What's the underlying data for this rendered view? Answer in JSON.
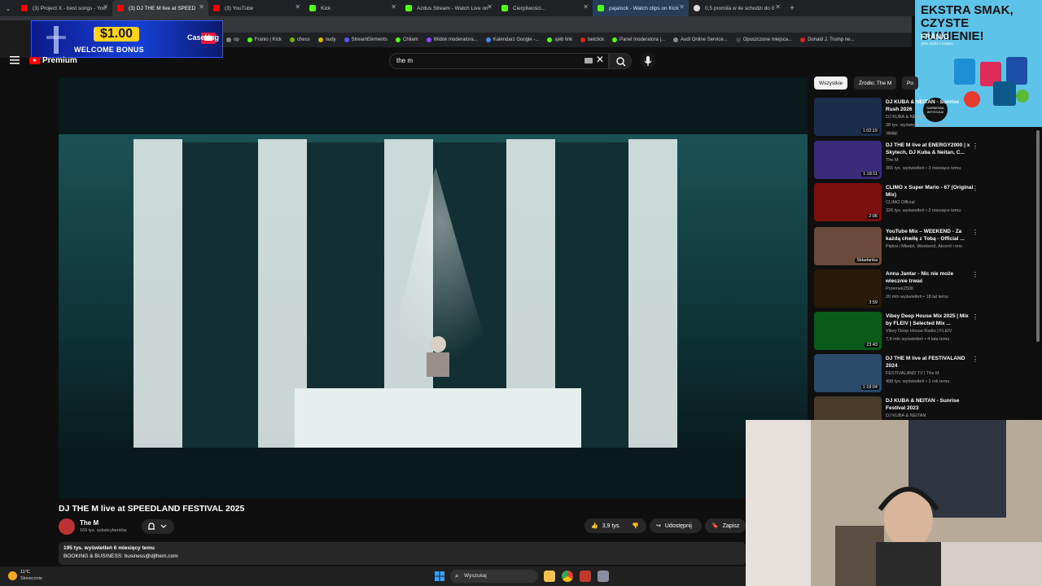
{
  "browser": {
    "tabs": [
      {
        "label": "(3) Project X - best songs - You",
        "icon": "youtube-icon"
      },
      {
        "label": "(3) DJ THE M live at SPEED",
        "icon": "youtube-icon",
        "active": true
      },
      {
        "label": "(3) YouTube",
        "icon": "youtube-icon"
      },
      {
        "label": "Kick",
        "icon": "kick-icon"
      },
      {
        "label": "Azdus Stream - Watch Live on",
        "icon": "kick-icon"
      },
      {
        "label": "Cierpliwości...",
        "icon": "kick-icon"
      },
      {
        "label": "pajalock - Watch clips on Kick",
        "icon": "kick-icon"
      },
      {
        "label": "0,5 promila w ile schodzi do 0",
        "icon": "google-icon"
      }
    ],
    "bookmarks": [
      {
        "label": "op",
        "color": "#888888"
      },
      {
        "label": "Franio | Kick",
        "color": "#53fc18"
      },
      {
        "label": "chess",
        "color": "#77b300"
      },
      {
        "label": "nudy",
        "color": "#e0b400"
      },
      {
        "label": "StreamElements",
        "color": "#5a5aff"
      },
      {
        "label": "Chilam",
        "color": "#53fc18"
      },
      {
        "label": "Widok moderatora...",
        "color": "#9146ff"
      },
      {
        "label": "Kalendarz Google -...",
        "color": "#4285f4"
      },
      {
        "label": "sjeb link",
        "color": "#53fc18"
      },
      {
        "label": "betclick",
        "color": "#e02020"
      },
      {
        "label": "Panel moderatora |...",
        "color": "#53fc18"
      },
      {
        "label": "Audi Online Service...",
        "color": "#888888"
      },
      {
        "label": "Opuszczone miejsca...",
        "color": "#444444"
      },
      {
        "label": "Donald J. Trump ne...",
        "color": "#e02020"
      }
    ]
  },
  "ads": {
    "casehug": {
      "amount": "$1.00",
      "bonus": "WELCOME BONUS",
      "brand": "CaseHug"
    },
    "franio": {
      "headline": "EKSTRA SMAK, CZYSTE SUMIENIE!",
      "brand": "FRANIO",
      "sub": "10% zniżki z kodem",
      "badge": "DARMOWA WYSYŁKA!"
    }
  },
  "youtube": {
    "logo": "Premium",
    "search": {
      "query": "the m"
    },
    "video": {
      "title": "DJ THE M live at SPEEDLAND FESTIVAL 2025",
      "channel": "The M",
      "subscribers": "169 tys. subskrybentów",
      "likes": "3,9 tys.",
      "share": "Udostępnij",
      "save": "Zapisz",
      "stats": "195 tys. wyświetleń  6 miesięcy temu",
      "description": "BOOKING & BUSINESS: business@djthem.com"
    },
    "chips": [
      "Wszystkie",
      "Źródło: The M",
      "Po"
    ],
    "recommendations": [
      {
        "title": "DJ KUBA & NEITAN - Sunrise Rush 2026",
        "channel": "DJ KUBA & NEITAN",
        "meta": "38 tys. wyświetleń • 3 dni temu",
        "duration": "1:02:19",
        "badge": "Nowy",
        "thumb": "#1a2d4a"
      },
      {
        "title": "DJ THE M live at ENERGY2000 | x Skytech, DJ Kuba & Neitan, C...",
        "channel": "The M",
        "meta": "365 tys. wyświetleń • 3 miesiące temu",
        "duration": "1:18:11",
        "thumb": "#3a2a7a"
      },
      {
        "title": "CLIMO x Super Mario - 67 (Original Mix)",
        "channel": "CLIMO Official",
        "meta": "326 tys. wyświetleń • 2 miesiące temu",
        "duration": "2:06",
        "thumb": "#7a1010"
      },
      {
        "title": "YouTube Mix – WEEKEND - Za każdą chwilę z Tobą - Official ...",
        "channel": "Piękni i Młodzi, Weekend, Akcent i inni",
        "meta": "",
        "duration": "Składanka",
        "thumb": "#6a4a3a"
      },
      {
        "title": "Anna Jantar - Nic nie może wiecznie trwać",
        "channel": "Przemek2500",
        "meta": "20 mln wyświetleń • 18 lat temu",
        "duration": "3:59",
        "thumb": "#2a1a0a"
      },
      {
        "title": "Vibey Deep House Mix 2025 | Mix by FLEIV | Selected Mix ...",
        "channel": "Vibey Deep House Radio | FLEIV",
        "meta": "7,8 mln wyświetleń • 4 lata temu",
        "duration": "23:43",
        "thumb": "#0a5a1a"
      },
      {
        "title": "DJ THE M live at FESTIVALAND 2024",
        "channel": "FESTIVALAND TV | The M",
        "meta": "498 tys. wyświetleń • 1 rok temu",
        "duration": "1:18:04",
        "thumb": "#2a4a6a"
      },
      {
        "title": "DJ KUBA & NEITAN - Sunrise Festival 2023",
        "channel": "DJ KUBA & NEITAN",
        "meta": "",
        "duration": "",
        "thumb": "#4a3a2a"
      }
    ]
  },
  "taskbar": {
    "temperature": "11°C",
    "weather": "Słonecznie",
    "search_placeholder": "Wyszukaj"
  }
}
